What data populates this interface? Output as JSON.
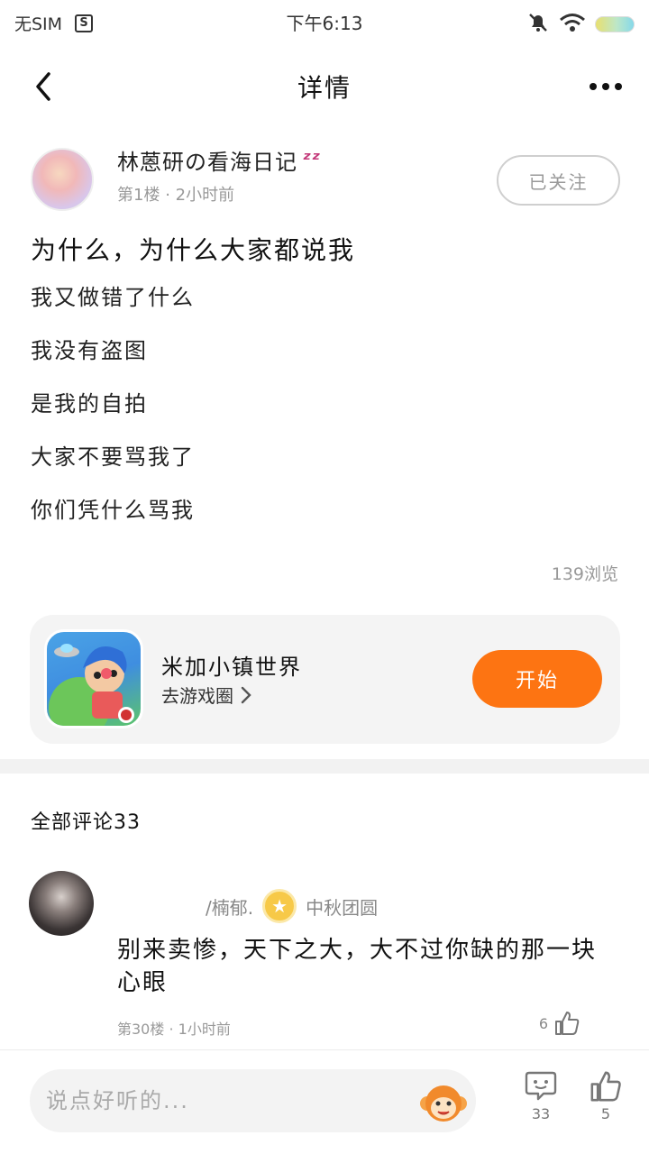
{
  "status_bar": {
    "carrier": "无SIM",
    "time": "下午6:13",
    "sim_icon_letter": "S"
  },
  "header": {
    "title": "详情"
  },
  "post": {
    "author_name": "林蒽研の看海日记",
    "floor": "第1楼",
    "time_ago": "2小时前",
    "follow_label": "已关注",
    "title": "为什么，为什么大家都说我",
    "lines": [
      "我又做错了什么",
      "我没有盗图",
      "是我的自拍",
      "大家不要骂我了",
      "你们凭什么骂我"
    ],
    "views": "139浏览"
  },
  "game_card": {
    "name": "米加小镇世界",
    "link_label": "去游戏圈",
    "start_label": "开始"
  },
  "comments": {
    "header": "全部评论33",
    "items": [
      {
        "user": "/楠郁.",
        "badge_label": "中秋团圆",
        "text": "别来卖惨，天下之大，大不过你缺的那一块心眼",
        "floor": "第30楼",
        "time_ago": "1小时前",
        "likes": "6"
      }
    ]
  },
  "bottom_bar": {
    "input_placeholder": "说点好听的...",
    "comment_count": "33",
    "like_count": "5"
  },
  "colors": {
    "accent": "#fd7412",
    "muted_text": "#999999",
    "card_bg": "#f4f4f4"
  }
}
